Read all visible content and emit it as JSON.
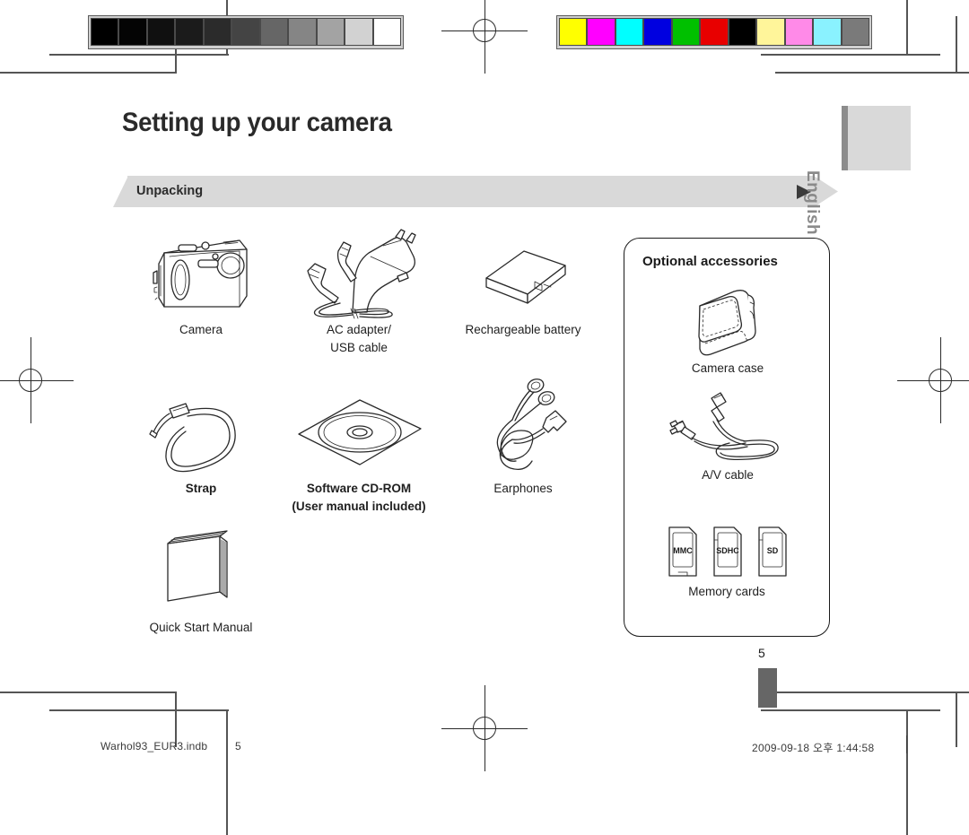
{
  "document": {
    "title": "Setting up your camera",
    "section_label": "Unpacking",
    "language_tab": "English",
    "page_number": "5"
  },
  "calibration": {
    "gray_strip": [
      "#000000",
      "#040404",
      "#101010",
      "#1b1b1b",
      "#2b2b2b",
      "#444444",
      "#666666",
      "#858585",
      "#a3a3a3",
      "#d2d2d2",
      "#ffffff"
    ],
    "color_strip": [
      "#ffff00",
      "#ff00ff",
      "#00ffff",
      "#0000e0",
      "#00c000",
      "#e80000",
      "#000000",
      "#fff59a",
      "#ff8ae8",
      "#8af2ff",
      "#7a7a7a"
    ]
  },
  "unpacking_items": [
    {
      "id": "camera",
      "icon": "camera-icon",
      "caption": "Camera"
    },
    {
      "id": "ac-adapter",
      "icon": "ac-adapter-usb-cable-icon",
      "caption": "AC adapter/\nUSB cable"
    },
    {
      "id": "battery",
      "icon": "rechargeable-battery-icon",
      "caption": "Rechargeable battery"
    },
    {
      "id": "strap",
      "icon": "strap-icon",
      "caption": "Strap"
    },
    {
      "id": "cdrom",
      "icon": "software-cd-rom-icon",
      "caption": "Software CD-ROM\n(User manual included)"
    },
    {
      "id": "earphones",
      "icon": "earphones-icon",
      "caption": "Earphones"
    },
    {
      "id": "manual",
      "icon": "quick-start-manual-icon",
      "caption": "Quick Start Manual"
    }
  ],
  "optional_accessories": {
    "header": "Optional accessories",
    "items": [
      {
        "id": "camera-case",
        "icon": "camera-case-icon",
        "caption": "Camera case"
      },
      {
        "id": "av-cable",
        "icon": "av-cable-icon",
        "caption": "A/V cable"
      },
      {
        "id": "memory-cards",
        "icon": "memory-cards-icon",
        "caption": "Memory cards"
      }
    ],
    "memory_card_labels": [
      "MMC",
      "SDHC",
      "SD"
    ]
  },
  "footer": {
    "file_name": "Warhol93_EUR3.indb",
    "page": "5",
    "date_time": "2009-09-18   오후 1:44:58"
  },
  "colors": {
    "banner_bg": "#d9d9d9",
    "banner_arrow": "#3b3b3b",
    "lang_tab": "#d9d9d9",
    "lang_spine": "#8c8c8c",
    "page_bar": "#666666",
    "line_art": "#2a2a2a"
  }
}
